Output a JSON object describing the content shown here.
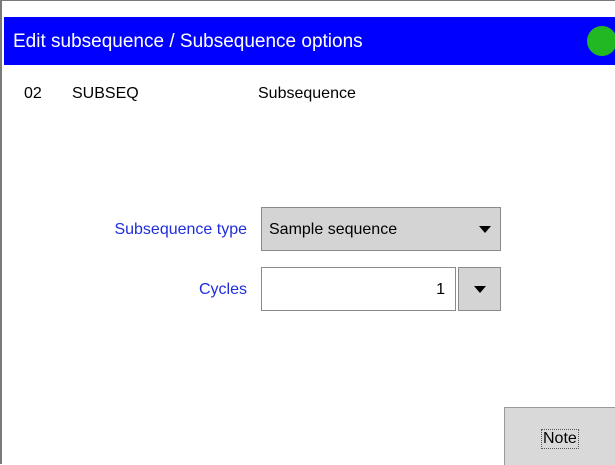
{
  "window": {
    "title": "Edit subsequence / Subsequence options",
    "status_color": "#22b822"
  },
  "info": {
    "number": "02",
    "code": "SUBSEQ",
    "description": "Subsequence"
  },
  "form": {
    "subsequence_type": {
      "label": "Subsequence type",
      "value": "Sample sequence"
    },
    "cycles": {
      "label": "Cycles",
      "value": "1"
    }
  },
  "buttons": {
    "note_label": "Note"
  },
  "colors": {
    "titlebar": "#0000ff",
    "label_text": "#1f2ddc"
  }
}
